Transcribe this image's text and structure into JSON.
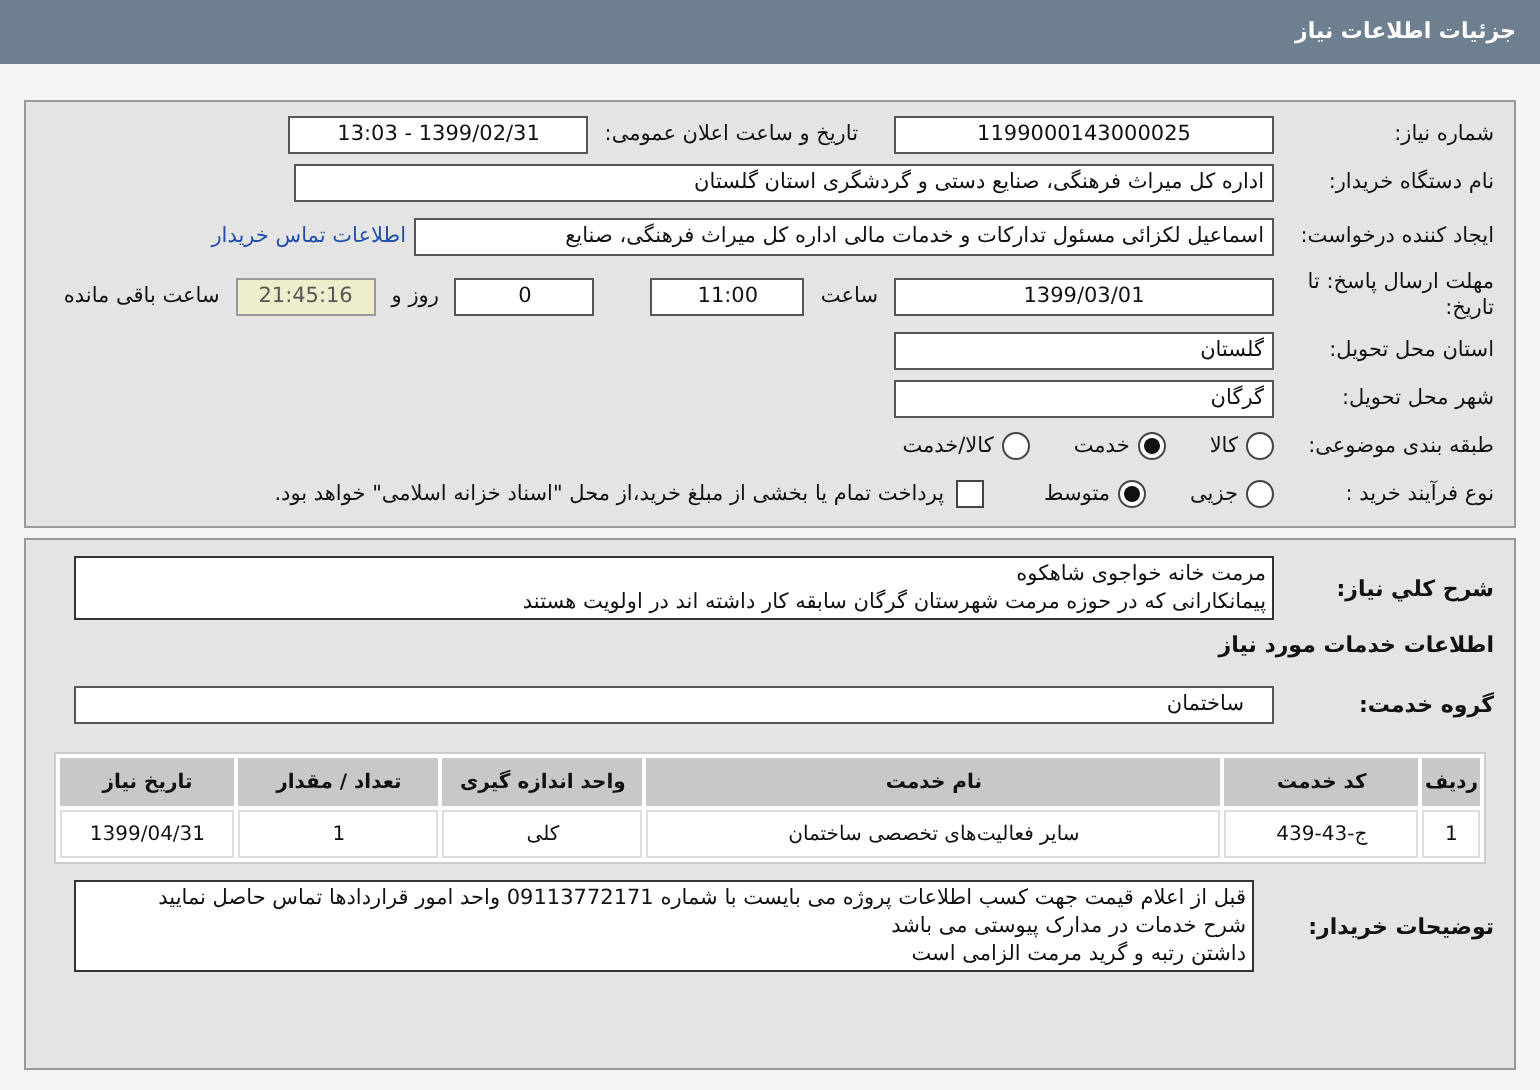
{
  "header": {
    "title": "جزئیات اطلاعات نیاز"
  },
  "need_number": {
    "label": "شماره نیاز:",
    "value": "1199000143000025"
  },
  "announce_date": {
    "label": "تاریخ و ساعت اعلان عمومی:",
    "value": "1399/02/31 - 13:03"
  },
  "buyer_org": {
    "label": "نام دستگاه خریدار:",
    "value": "اداره کل میراث فرهنگی، صنایع دستی و گردشگری استان گلستان"
  },
  "requester": {
    "label": "ایجاد کننده درخواست:",
    "value": "اسماعیل لکزائی مسئول تدارکات و خدمات مالی اداره کل میراث فرهنگی، صنایع",
    "link": "اطلاعات تماس خریدار"
  },
  "deadline": {
    "label": "مهلت ارسال پاسخ: تا تاریخ:",
    "date": "1399/03/01",
    "time_label": "ساعت",
    "time": "11:00",
    "days": "0",
    "days_label": "روز و",
    "remaining": "21:45:16",
    "remaining_label": "ساعت باقی مانده"
  },
  "province": {
    "label": "استان محل تحویل:",
    "value": "گلستان"
  },
  "city": {
    "label": "شهر محل تحویل:",
    "value": "گرگان"
  },
  "category": {
    "label": "طبقه بندی موضوعی:",
    "options": [
      {
        "label": "کالا",
        "selected": false
      },
      {
        "label": "خدمت",
        "selected": true
      },
      {
        "label": "کالا/خدمت",
        "selected": false
      }
    ]
  },
  "process": {
    "label": "نوع فرآیند خرید :",
    "options": [
      {
        "label": "جزیی",
        "selected": false
      },
      {
        "label": "متوسط",
        "selected": true
      }
    ],
    "payment": {
      "label": "پرداخت تمام یا بخشی از مبلغ خرید،از محل \"اسناد خزانه اسلامی\" خواهد بود.",
      "checked": false
    }
  },
  "description": {
    "label": "شرح کلي نیاز:",
    "lines": [
      "مرمت خانه خواجوی شاهکوه",
      "پیمانکارانی که در حوزه مرمت شهرستان گرگان سابقه کار داشته اند در اولویت هستند"
    ]
  },
  "services_title": "اطلاعات خدمات مورد نیاز",
  "service_group": {
    "label": "گروه خدمت:",
    "value": "ساختمان"
  },
  "table": {
    "columns": [
      "ردیف",
      "کد خدمت",
      "نام خدمت",
      "واحد اندازه گیری",
      "تعداد / مقدار",
      "تاریخ نیاز"
    ],
    "rows": [
      [
        "1",
        "ج-43-439",
        "سایر فعالیت‌های تخصصی ساختمان",
        "کلی",
        "1",
        "1399/04/31"
      ]
    ]
  },
  "buyer_notes": {
    "label": "توضیحات خریدار:",
    "lines": [
      "قبل از اعلام قیمت جهت کسب اطلاعات پروژه می بایست با شماره 09113772171 واحد امور قراردادها تماس حاصل نمایید",
      "شرح خدمات در مدارک پیوستی می باشد",
      "داشتن رتبه و گرید مرمت الزامی است"
    ]
  }
}
